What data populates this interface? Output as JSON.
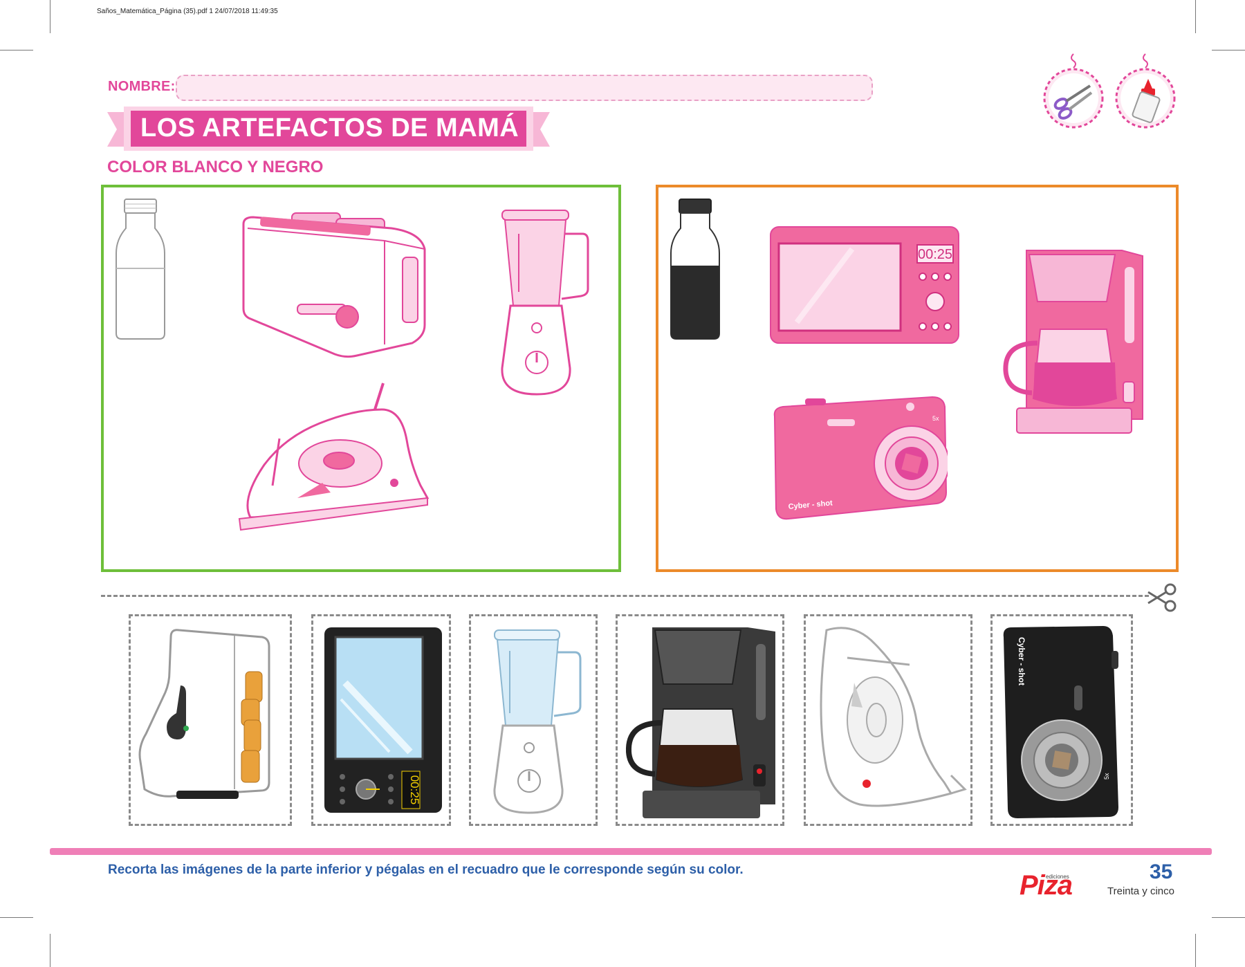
{
  "print_header": "Saños_Matemática_Página (35).pdf   1   24/07/2018   11:49:35",
  "nombre_label": "NOMBRE:",
  "title": "LOS ARTEFACTOS DE MAMÁ",
  "subtitle": "COLOR BLANCO Y NEGRO",
  "tools": [
    "scissors-icon",
    "glue-icon"
  ],
  "white_box": {
    "indicator": "white-bottle-icon",
    "items": [
      "toaster-icon",
      "blender-icon",
      "iron-icon"
    ]
  },
  "black_box": {
    "indicator": "black-bottle-icon",
    "items": [
      "microwave-icon",
      "coffee-maker-icon",
      "camera-icon"
    ],
    "microwave_display": "00:25",
    "camera_brand": "Cyber - shot",
    "camera_zoom": "5x"
  },
  "cutouts": [
    {
      "name": "white-toaster-icon"
    },
    {
      "name": "black-microwave-icon",
      "display": "00:25"
    },
    {
      "name": "white-blender-icon"
    },
    {
      "name": "black-coffee-maker-icon"
    },
    {
      "name": "white-iron-icon"
    },
    {
      "name": "black-camera-icon",
      "brand": "Cyber - shot",
      "zoom": "5x"
    }
  ],
  "instruction": "Recorta las imágenes de la parte inferior y pégalas en el recuadro que le corresponde según su color.",
  "brand": {
    "small": "ediciones",
    "name": "Piza"
  },
  "page_number": "35",
  "page_words": "Treinta y cinco",
  "colors": {
    "pink": "#e2479a",
    "green": "#6ebf3a",
    "orange": "#ec8a2a",
    "blue": "#2d5fa8"
  }
}
